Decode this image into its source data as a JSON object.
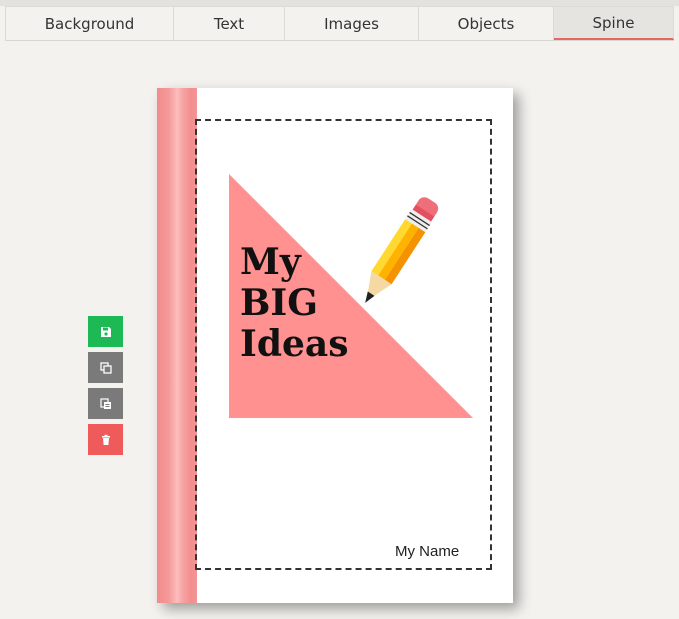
{
  "tabs": [
    {
      "label": "Background",
      "active": false
    },
    {
      "label": "Text",
      "active": false
    },
    {
      "label": "Images",
      "active": false
    },
    {
      "label": "Objects",
      "active": false
    },
    {
      "label": "Spine",
      "active": true
    }
  ],
  "tools": [
    {
      "name": "save-icon",
      "color": "#1db954"
    },
    {
      "name": "copy-icon",
      "color": "#7a7a7a"
    },
    {
      "name": "paste-icon",
      "color": "#7a7a7a"
    },
    {
      "name": "trash-icon",
      "color": "#ef5a5a"
    }
  ],
  "cover": {
    "title_lines": [
      "My",
      "BIG",
      "Ideas"
    ],
    "author": "My Name",
    "spine_color": "#f49a9a",
    "triangle_color": "#ff9190"
  }
}
